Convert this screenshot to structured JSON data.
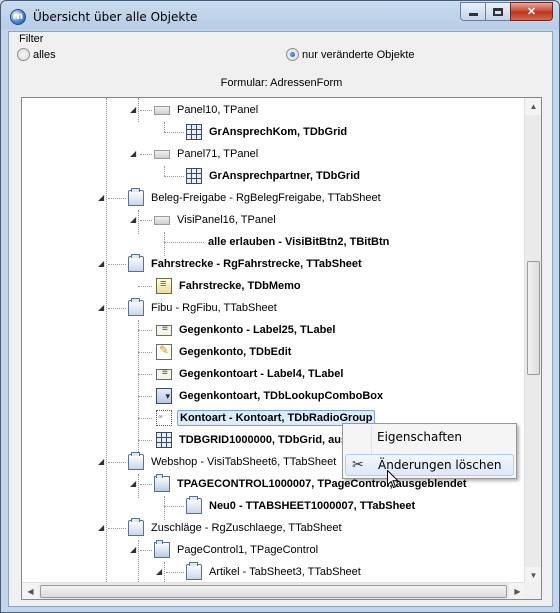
{
  "window": {
    "title": "Übersicht über alle Objekte",
    "app_icon_letter": "m"
  },
  "filter": {
    "group_label": "Filter",
    "options": [
      {
        "label": "alles",
        "checked": false
      },
      {
        "label": "nur veränderte Objekte",
        "checked": true
      }
    ]
  },
  "formular_label": "Formular: AdressenForm",
  "tree": {
    "nodes": [
      {
        "label": "Panel10, TPanel",
        "icon": "panel-icon",
        "bold": false
      },
      {
        "label": "GrAnsprechKom, TDbGrid",
        "icon": "grid-icon",
        "bold": true
      },
      {
        "label": "Panel71, TPanel",
        "icon": "panel-icon",
        "bold": false
      },
      {
        "label": "GrAnsprechpartner, TDbGrid",
        "icon": "grid-icon",
        "bold": true
      },
      {
        "label": "Beleg-Freigabe - RgBelegFreigabe, TTabSheet",
        "icon": "tabsheet-icon",
        "bold": false
      },
      {
        "label": "VisiPanel16, TPanel",
        "icon": "panel-icon",
        "bold": false
      },
      {
        "label": "alle erlauben - VisiBitBtn2, TBitBtn",
        "icon": "none",
        "bold": true
      },
      {
        "label": "Fahrstrecke - RgFahrstrecke, TTabSheet",
        "icon": "tabsheet-icon",
        "bold": true
      },
      {
        "label": "Fahrstrecke, TDbMemo",
        "icon": "memo-icon",
        "bold": true
      },
      {
        "label": "Fibu - RgFibu, TTabSheet",
        "icon": "tabsheet-icon",
        "bold": false
      },
      {
        "label": "Gegenkonto - Label25, TLabel",
        "icon": "label-icon",
        "bold": true
      },
      {
        "label": "Gegenkonto, TDbEdit",
        "icon": "edit-icon",
        "bold": true
      },
      {
        "label": "Gegenkontoart - Label4, TLabel",
        "icon": "label-icon",
        "bold": true
      },
      {
        "label": "Gegenkontoart, TDbLookupComboBox",
        "icon": "combobox-icon",
        "bold": true
      },
      {
        "label": "Kontoart - Kontoart, TDbRadioGroup",
        "icon": "radiogroup-icon",
        "bold": true
      },
      {
        "label": "TDBGRID1000000, TDbGrid, aus",
        "icon": "grid-icon",
        "bold": true
      },
      {
        "label": "Webshop - VisiTabSheet6, TTabSheet",
        "icon": "tabsheet-icon",
        "bold": false
      },
      {
        "label": "TPAGECONTROL1000007, TPageControl, ausgeblendet",
        "icon": "pagecontrol-icon",
        "bold": true
      },
      {
        "label": "Neu0 - TTABSHEET1000007, TTabSheet",
        "icon": "tabsheet-icon",
        "bold": true
      },
      {
        "label": "Zuschläge - RgZuschlaege, TTabSheet",
        "icon": "tabsheet-icon",
        "bold": false
      },
      {
        "label": "PageControl1, TPageControl",
        "icon": "pagecontrol-icon",
        "bold": false
      },
      {
        "label": "Artikel - TabSheet3, TTabSheet",
        "icon": "tabsheet-icon",
        "bold": false
      }
    ],
    "selected_label": "Kontoart - Kontoart, TDbRadioGroup"
  },
  "context_menu": {
    "items": [
      {
        "label": "Eigenschaften",
        "icon": "none",
        "hover": false
      },
      {
        "label": "Änderungen löschen",
        "icon": "scissors-icon",
        "hover": true
      }
    ]
  },
  "colors": {
    "title_bar": "#b7cde6",
    "close_button": "#c7432c",
    "selection_bg": "#dcecfc",
    "selection_border": "#7da2ce",
    "menu_hover_border": "#aecff7"
  }
}
